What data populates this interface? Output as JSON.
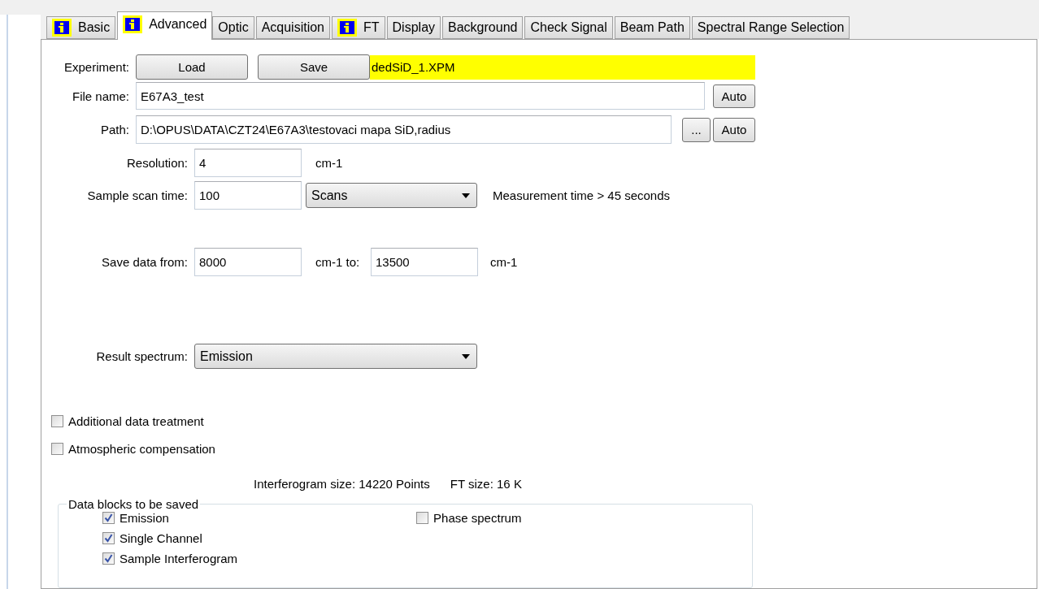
{
  "tabs": [
    {
      "label": "Basic",
      "info": true,
      "selected": false
    },
    {
      "label": "Advanced",
      "info": true,
      "selected": true
    },
    {
      "label": "Optic",
      "info": false,
      "selected": false
    },
    {
      "label": "Acquisition",
      "info": false,
      "selected": false
    },
    {
      "label": "FT",
      "info": true,
      "selected": false
    },
    {
      "label": "Display",
      "info": false,
      "selected": false
    },
    {
      "label": "Background",
      "info": false,
      "selected": false
    },
    {
      "label": "Check Signal",
      "info": false,
      "selected": false
    },
    {
      "label": "Beam Path",
      "info": false,
      "selected": false
    },
    {
      "label": "Spectral Range Selection",
      "info": false,
      "selected": false
    }
  ],
  "experiment": {
    "label": "Experiment:",
    "buttons": [
      "Load",
      "Save"
    ],
    "file": "dedSiD_1.XPM"
  },
  "file_name": {
    "label": "File name:",
    "value": "E67A3_test",
    "buttons": [
      "Auto"
    ]
  },
  "path": {
    "label": "Path:",
    "value": "D:\\OPUS\\DATA\\CZT24\\E67A3\\testovaci mapa SiD,radius",
    "buttons": [
      "...",
      "Auto"
    ]
  },
  "resolution": {
    "label": "Resolution:",
    "value": "4",
    "unit": "cm-1"
  },
  "scan_time": {
    "label": "Sample scan time:",
    "value": "100",
    "select": "Scans",
    "note": "Measurement time > 45 seconds"
  },
  "save_data": {
    "label": "Save data from:",
    "from": "8000",
    "unit_from": "cm-1 to:",
    "to": "13500",
    "unit_to": "cm-1"
  },
  "result_spectrum": {
    "label": "Result spectrum:",
    "select": "Emission"
  },
  "options": [
    {
      "label": "Additional data treatment",
      "checked": false
    },
    {
      "label": "Atmospheric compensation",
      "checked": false
    }
  ],
  "info": [
    "Interferogram size: 14220 Points",
    "FT size: 16 K"
  ],
  "data_blocks": {
    "title": "Data blocks to be saved",
    "left_items": [
      {
        "label": "Emission",
        "checked": true
      },
      {
        "label": "Single Channel",
        "checked": true
      },
      {
        "label": "Sample Interferogram",
        "checked": true
      }
    ],
    "right_items": [
      {
        "label": "Phase spectrum",
        "checked": false
      }
    ]
  }
}
